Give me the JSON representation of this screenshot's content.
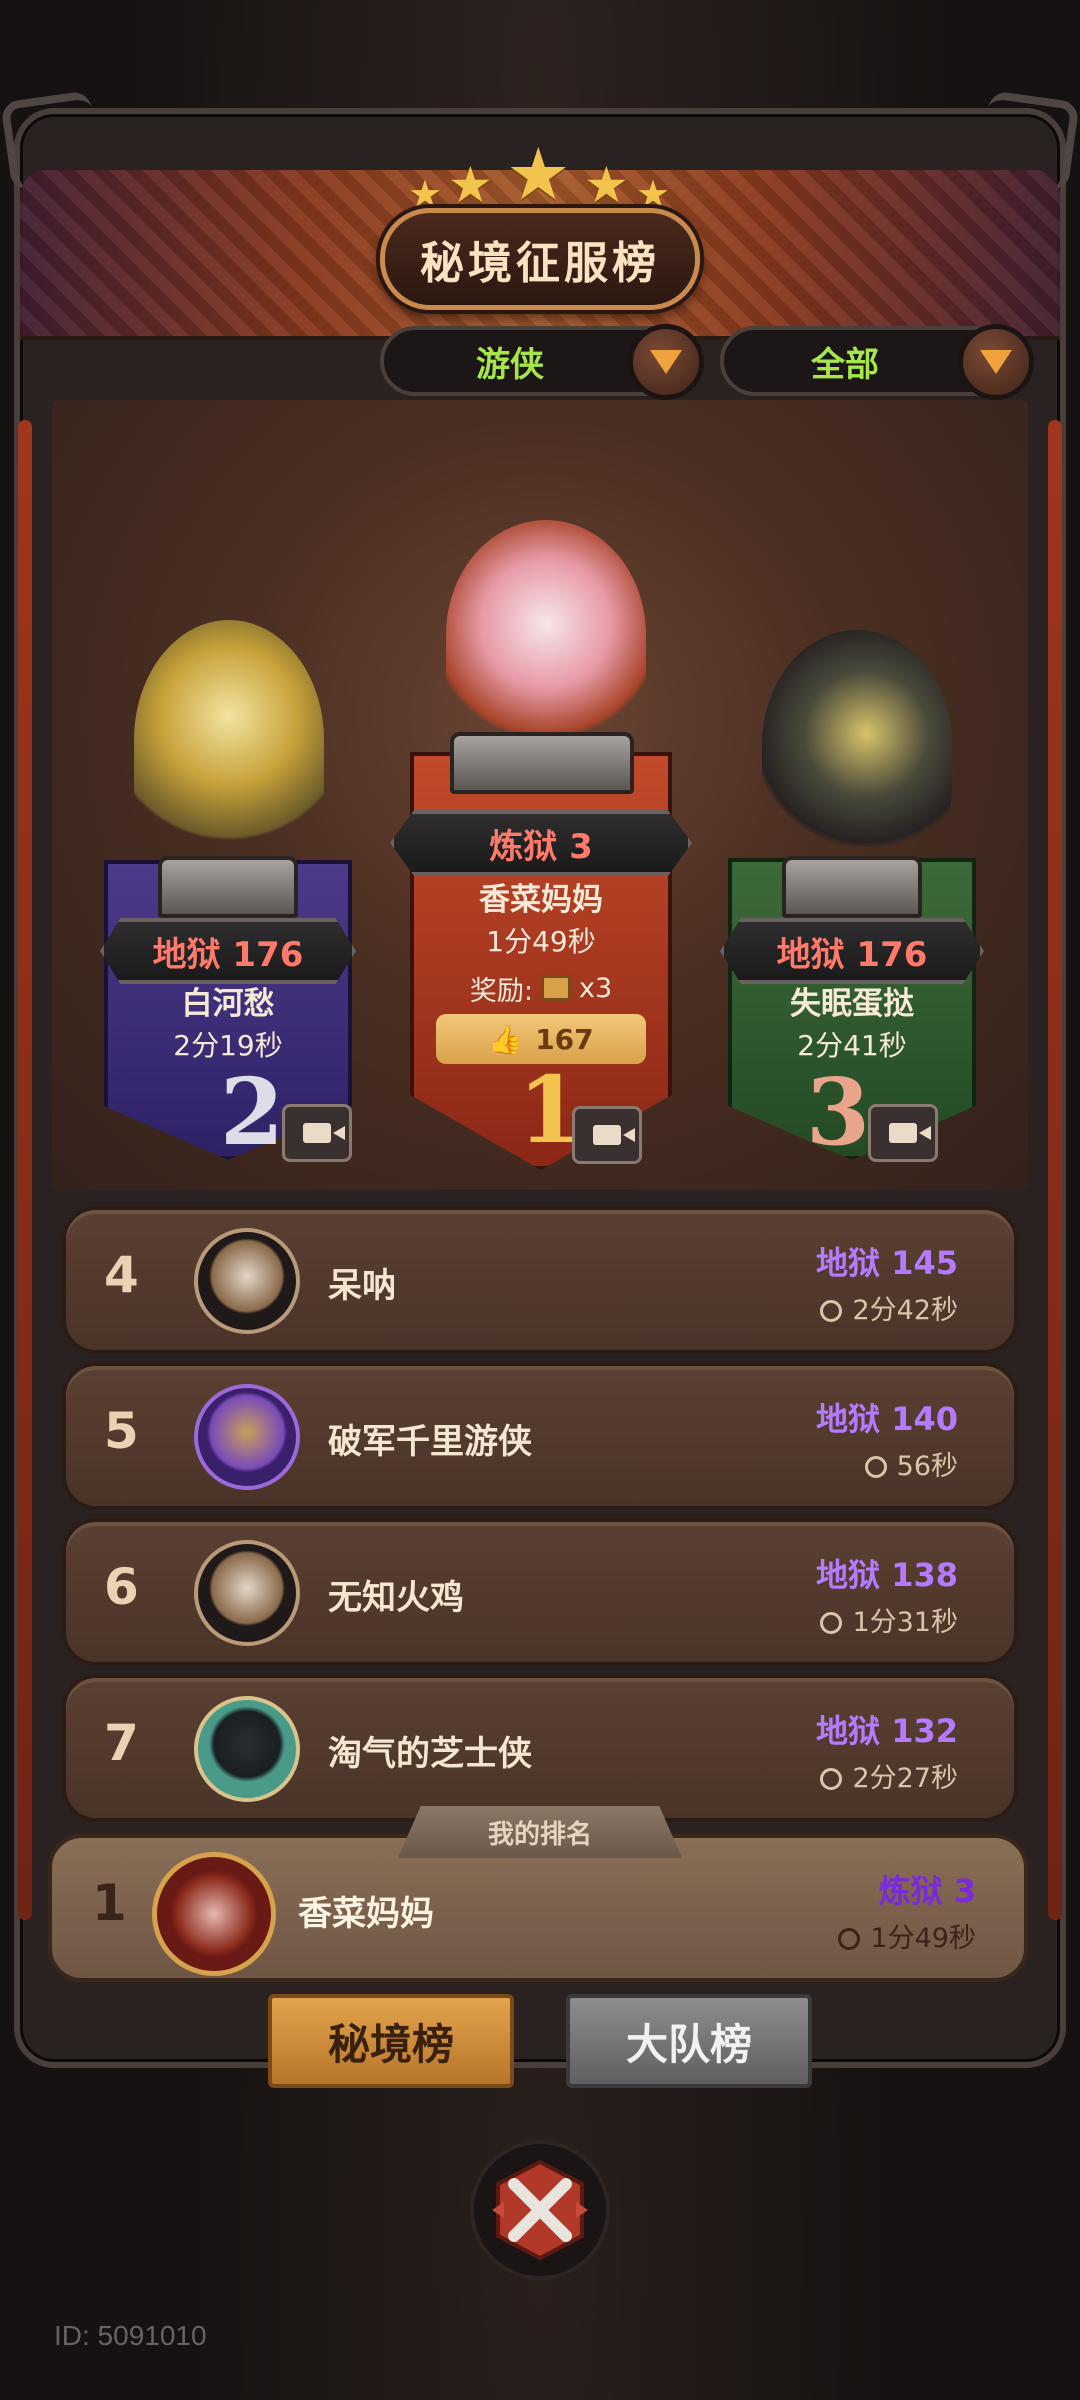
{
  "header": {
    "title": "秘境征服榜",
    "star_count": 5
  },
  "filters": {
    "class_filter": "游侠",
    "scope_filter": "全部"
  },
  "podium": {
    "first": {
      "rank": "1",
      "score": "炼狱 3",
      "name": "香菜妈妈",
      "time": "1分49秒",
      "reward_label": "奖励:",
      "reward_count": "x3",
      "likes": "167"
    },
    "second": {
      "rank": "2",
      "score": "地狱 176",
      "name": "白河愁",
      "time": "2分19秒"
    },
    "third": {
      "rank": "3",
      "score": "地狱 176",
      "name": "失眠蛋挞",
      "time": "2分41秒"
    }
  },
  "list": [
    {
      "rank": "4",
      "name": "呆呐",
      "score": "地狱 145",
      "time": "2分42秒"
    },
    {
      "rank": "5",
      "name": "破军千里游侠",
      "score": "地狱 140",
      "time": "56秒"
    },
    {
      "rank": "6",
      "name": "无知火鸡",
      "score": "地狱 138",
      "time": "1分31秒"
    },
    {
      "rank": "7",
      "name": "淘气的芝士侠",
      "score": "地狱 132",
      "time": "2分27秒"
    }
  ],
  "my_rank": {
    "tab_label": "我的排名",
    "rank": "1",
    "name": "香菜妈妈",
    "score": "炼狱 3",
    "time": "1分49秒"
  },
  "tabs": {
    "active": "秘境榜",
    "inactive": "大队榜"
  },
  "footer": {
    "id_text": "ID: 5091010"
  },
  "colors": {
    "score_purple": "#b57bff",
    "score_red": "#ff7a6a",
    "filter_green": "#a6e64a",
    "gold": "#f2c44e"
  }
}
